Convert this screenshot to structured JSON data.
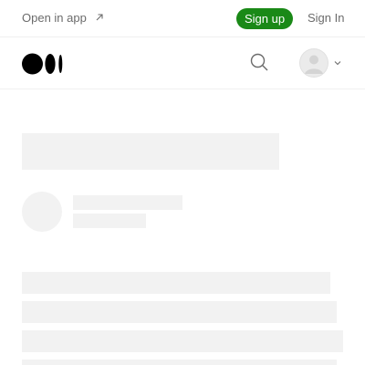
{
  "topbar": {
    "open_app_label": "Open in app",
    "signup_label": "Sign up",
    "signin_label": "Sign In"
  },
  "navbar": {
    "logo_icon": "medium-logo-icon",
    "search_icon": "search-icon",
    "avatar_icon": "user-avatar-icon",
    "chevron_icon": "chevron-down-icon"
  },
  "colors": {
    "signup_bg": "#1a8917",
    "skeleton": "#f2f2f2",
    "muted_text": "#6b6b6b"
  }
}
